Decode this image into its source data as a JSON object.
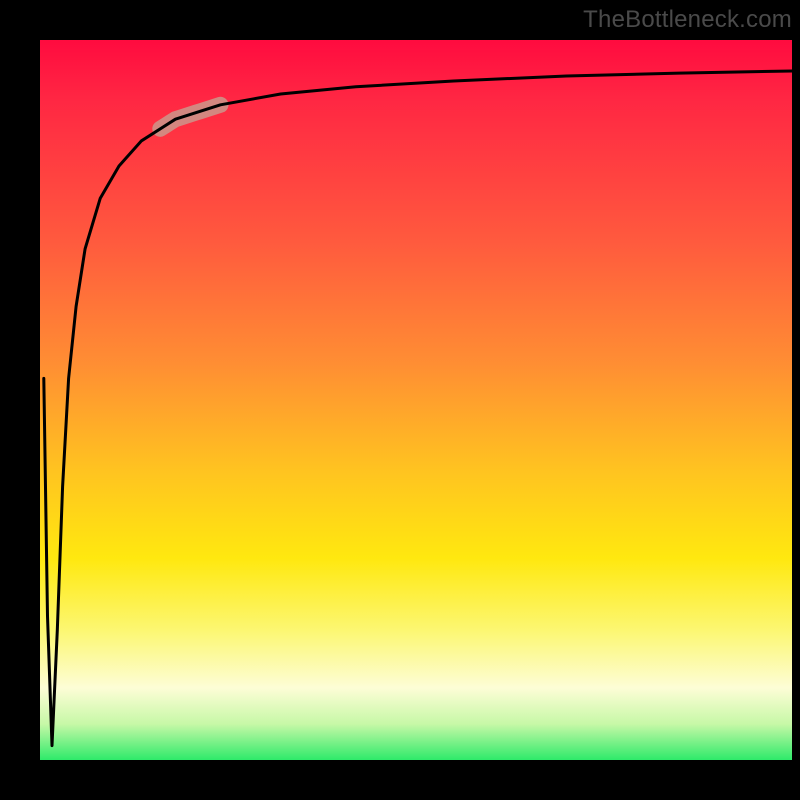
{
  "watermark": "TheBottleneck.com",
  "chart_data": {
    "type": "line",
    "title": "",
    "xlabel": "",
    "ylabel": "",
    "xlim": [
      0,
      100
    ],
    "ylim": [
      0,
      100
    ],
    "background_gradient": {
      "orientation": "vertical",
      "stops": [
        {
          "pct": 0,
          "color": "#ff0b3f"
        },
        {
          "pct": 28,
          "color": "#ff5a3e"
        },
        {
          "pct": 60,
          "color": "#ffc420"
        },
        {
          "pct": 82,
          "color": "#fcf772"
        },
        {
          "pct": 95,
          "color": "#c7f8a7"
        },
        {
          "pct": 100,
          "color": "#2eea6a"
        }
      ]
    },
    "series": [
      {
        "name": "bottleneck-curve",
        "color": "#000000",
        "x": [
          0.5,
          1.0,
          1.6,
          2.3,
          3.0,
          3.8,
          4.8,
          6.0,
          8.0,
          10.5,
          13.5,
          18.0,
          24.0,
          32.0,
          42.0,
          55.0,
          70.0,
          85.0,
          100.0
        ],
        "y": [
          53.0,
          20.0,
          2.0,
          18.0,
          38.0,
          53.0,
          63.0,
          71.0,
          78.0,
          82.5,
          86.0,
          89.0,
          91.0,
          92.5,
          93.5,
          94.3,
          95.0,
          95.4,
          95.7
        ]
      }
    ],
    "highlight_segment": {
      "on_series": "bottleneck-curve",
      "x_start": 16.0,
      "x_end": 24.0,
      "color": "#cf8f86",
      "width": 16
    }
  }
}
